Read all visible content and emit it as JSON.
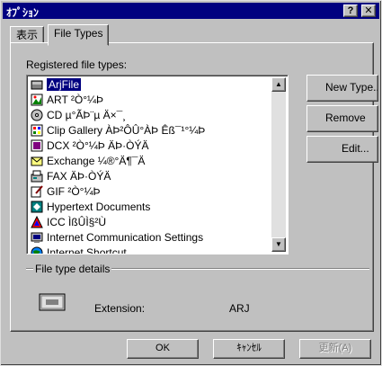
{
  "window": {
    "title": "ｵﾌﾟｼｮﾝ"
  },
  "titlebar": {
    "help_glyph": "?",
    "close_glyph": "✕"
  },
  "tabs": [
    {
      "label": "表示"
    },
    {
      "label": "File Types"
    }
  ],
  "registered": {
    "label": "Registered file types:",
    "items": [
      {
        "label": "ArjFile",
        "icon": "arj-file-icon",
        "selected": true
      },
      {
        "label": "ART ²Ò°¼Þ",
        "icon": "image-icon"
      },
      {
        "label": "CD µ°ÃÞ¨µ Ä×¯¸",
        "icon": "cd-audio-icon"
      },
      {
        "label": "Clip Gallery ÀÞ²ÔÛ°ÀÞ Êß¯¹°¼Þ",
        "icon": "clip-gallery-icon"
      },
      {
        "label": "DCX ²Ò°¼Þ ÄÞ·­ÒÝÄ",
        "icon": "image-icon"
      },
      {
        "label": "Exchange ¼®°Ä¶¯Ä",
        "icon": "exchange-icon"
      },
      {
        "label": "FAX ÄÞ·­ÒÝÄ",
        "icon": "fax-icon"
      },
      {
        "label": "GIF ²Ò°¼Þ",
        "icon": "image-edit-icon"
      },
      {
        "label": "Hypertext Documents",
        "icon": "html-doc-icon"
      },
      {
        "label": "ICC ÌßÛÌ§²Ù",
        "icon": "icc-profile-icon"
      },
      {
        "label": "Internet Communication Settings",
        "icon": "internet-settings-icon"
      },
      {
        "label": "Internet Shortcut",
        "icon": "internet-shortcut-icon"
      }
    ]
  },
  "side_buttons": {
    "new": "New Type...",
    "remove": "Remove",
    "edit": "Edit..."
  },
  "details": {
    "label": "File type details",
    "extension_label": "Extension:",
    "extension_value": "ARJ"
  },
  "footer": {
    "ok": "OK",
    "cancel": "ｷｬﾝｾﾙ",
    "apply": "更新(A)"
  }
}
